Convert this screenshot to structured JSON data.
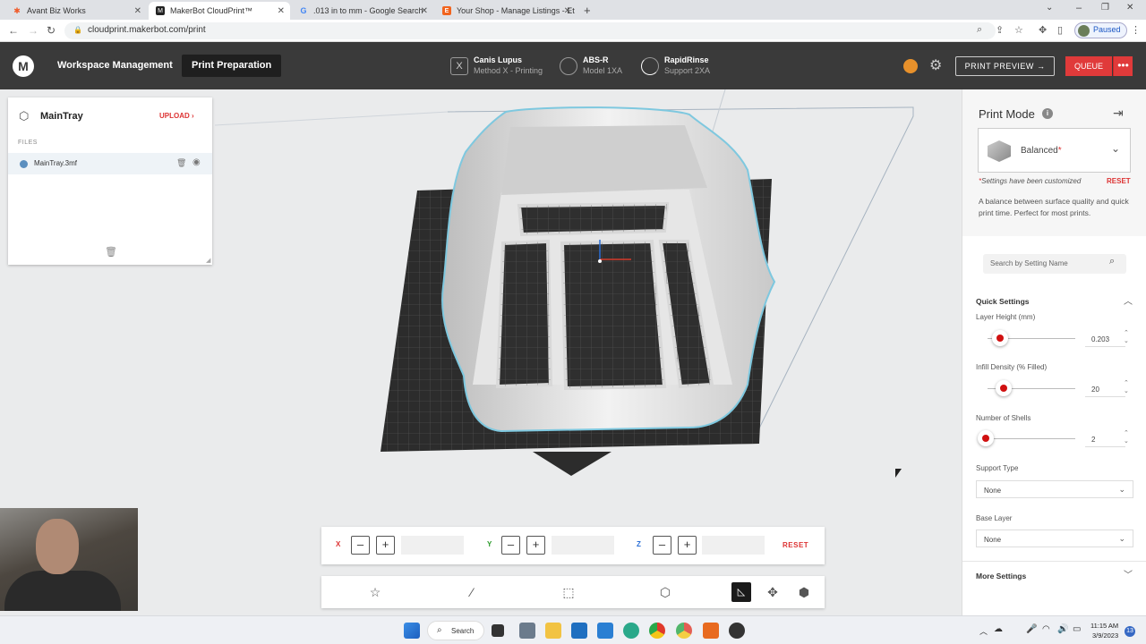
{
  "browser": {
    "tabs": [
      {
        "title": "Avant Biz Works",
        "icon": "hubspot-icon"
      },
      {
        "title": "MakerBot CloudPrint™",
        "icon": "makerbot-icon"
      },
      {
        "title": ".013 in to mm - Google Search",
        "icon": "google-icon"
      },
      {
        "title": "Your Shop - Manage Listings - Et",
        "icon": "etsy-icon"
      }
    ],
    "url": "cloudprint.makerbot.com/print",
    "profile_status": "Paused"
  },
  "app": {
    "nav": {
      "workspace": "Workspace Management",
      "print_prep": "Print Preparation"
    },
    "devices": [
      {
        "line1": "Canis Lupus",
        "line2": "Method X - Printing",
        "icon": "printer-icon"
      },
      {
        "line1": "ABS-R",
        "line2": "Model 1XA",
        "icon": "material-spool-icon"
      },
      {
        "line1": "RapidRinse",
        "line2": "Support 2XA",
        "icon": "support-spool-icon"
      }
    ],
    "print_preview": "PRINT PREVIEW",
    "queue": "QUEUE"
  },
  "left_panel": {
    "tray_name": "MainTray",
    "upload": "UPLOAD",
    "files_label": "FILES",
    "files": [
      {
        "name": "MainTray.3mf"
      }
    ]
  },
  "coords": {
    "x_label": "X",
    "y_label": "Y",
    "z_label": "Z",
    "minus": "–",
    "plus": "+",
    "reset": "RESET"
  },
  "right_panel": {
    "title": "Print Mode",
    "mode": "Balanced",
    "mode_marker": "*",
    "customized_note": "Settings have been customized",
    "reset": "RESET",
    "description": "A balance between surface quality and quick print time. Perfect for most prints.",
    "search_placeholder": "Search by Setting Name",
    "quick_settings": "Quick Settings",
    "layer_height_label": "Layer Height (mm)",
    "layer_height_value": "0.203",
    "infill_label": "Infill Density (% Filled)",
    "infill_value": "20",
    "shells_label": "Number of Shells",
    "shells_value": "2",
    "support_type_label": "Support Type",
    "support_type_value": "None",
    "base_layer_label": "Base Layer",
    "base_layer_value": "None",
    "more_settings": "More Settings"
  },
  "taskbar": {
    "search": "Search",
    "time": "11:15 AM",
    "date": "3/9/2023",
    "notification_count": "13"
  }
}
